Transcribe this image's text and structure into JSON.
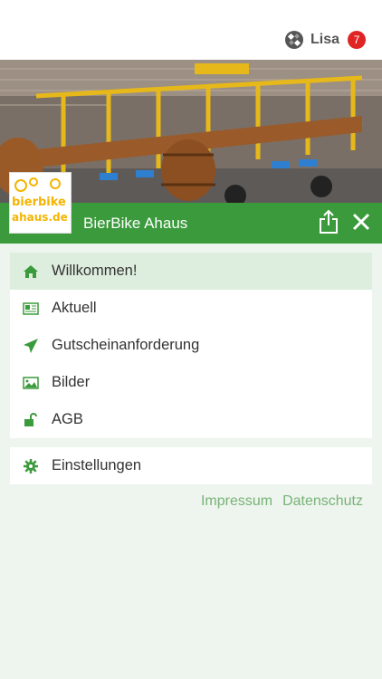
{
  "topbar": {
    "user_name": "Lisa",
    "notification_count": "7",
    "badge_color": "#e02424"
  },
  "hero": {
    "image_subject": "beer-bike-vehicle"
  },
  "logo": {
    "line1": "bierbike",
    "line2": "ahaus.de",
    "color": "#f5b400"
  },
  "appbar": {
    "title": "BierBike Ahaus",
    "color": "#3b9a3c",
    "share_icon": "share-icon",
    "close_icon": "close-icon"
  },
  "menu": {
    "items": [
      {
        "label": "Willkommen!",
        "icon": "home-icon",
        "active": true
      },
      {
        "label": "Aktuell",
        "icon": "newspaper-icon",
        "active": false
      },
      {
        "label": "Gutscheinanforderung",
        "icon": "paper-plane-icon",
        "active": false
      },
      {
        "label": "Bilder",
        "icon": "image-icon",
        "active": false
      },
      {
        "label": "AGB",
        "icon": "unlock-icon",
        "active": false
      }
    ],
    "settings": {
      "label": "Einstellungen",
      "icon": "gear-icon"
    }
  },
  "footer": {
    "impressum": "Impressum",
    "datenschutz": "Datenschutz"
  }
}
